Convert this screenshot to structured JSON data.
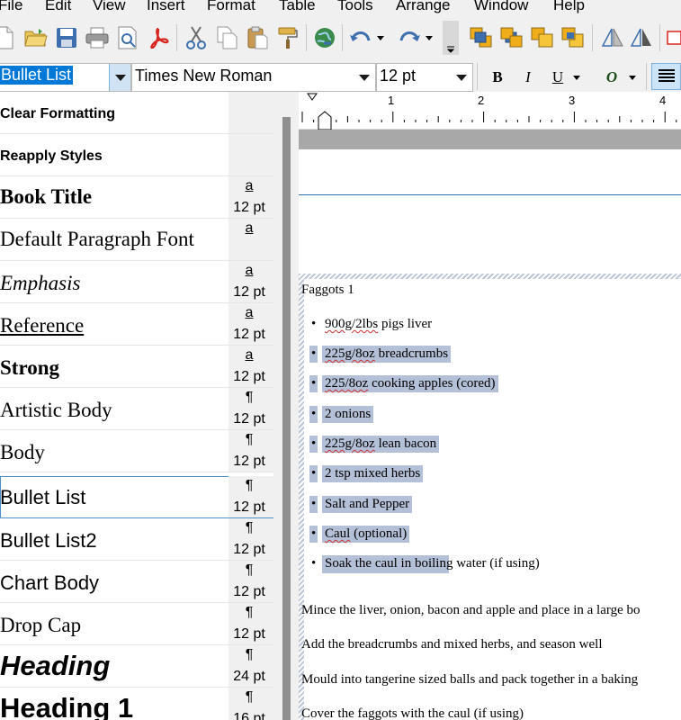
{
  "menu": [
    "File",
    "Edit",
    "View",
    "Insert",
    "Format",
    "Table",
    "Tools",
    "Arrange",
    "Window",
    "Help"
  ],
  "toolbar": {
    "icons": [
      "new-document-icon",
      "open-folder-icon",
      "save-icon",
      "print-icon",
      "print-preview-icon",
      "pdf-export-icon",
      "cut-icon",
      "copy-icon",
      "paste-icon",
      "format-painter-icon",
      "insert-hyperlink-icon",
      "undo-icon",
      "redo-icon",
      "bring-to-front-icon",
      "send-to-back-icon",
      "bring-forward-icon",
      "send-backward-icon",
      "flip-horizontal-icon",
      "flip-vertical-icon"
    ]
  },
  "format": {
    "style": "Bullet List",
    "font": "Times New Roman",
    "size": "12 pt",
    "bold": "B",
    "italic": "I",
    "underline": "U",
    "outline": "O"
  },
  "styles": [
    {
      "name": "Clear Formatting",
      "glyph": "",
      "size": ""
    },
    {
      "name": "Reapply Styles",
      "glyph": "",
      "size": ""
    },
    {
      "name": "Book Title",
      "glyph": "a",
      "size": "12 pt"
    },
    {
      "name": "Default Paragraph Font",
      "glyph": "a",
      "size": ""
    },
    {
      "name": "Emphasis",
      "glyph": "a",
      "size": "12 pt"
    },
    {
      "name": "Reference",
      "glyph": "a",
      "size": "12 pt"
    },
    {
      "name": "Strong",
      "glyph": "a",
      "size": "12 pt"
    },
    {
      "name": "Artistic Body",
      "glyph": "¶",
      "size": "12 pt"
    },
    {
      "name": "Body",
      "glyph": "¶",
      "size": "12 pt"
    },
    {
      "name": "Bullet List",
      "glyph": "¶",
      "size": "12 pt"
    },
    {
      "name": "Bullet List2",
      "glyph": "¶",
      "size": "12 pt"
    },
    {
      "name": "Chart Body",
      "glyph": "¶",
      "size": "12 pt"
    },
    {
      "name": "Drop Cap",
      "glyph": "¶",
      "size": "12 pt"
    },
    {
      "name": "Heading",
      "glyph": "¶",
      "size": "24 pt"
    },
    {
      "name": "Heading 1",
      "glyph": "¶",
      "size": "16 pt"
    }
  ],
  "ruler": [
    "1",
    "2",
    "3",
    "4"
  ],
  "document": {
    "title": "Faggots 1",
    "ingredients": [
      {
        "pre": "900g/2lbs",
        "text": " pigs liver"
      },
      {
        "pre": "225g/8oz",
        "text": " breadcrumbs"
      },
      {
        "pre": "225/8oz",
        "text": " cooking apples (cored)"
      },
      {
        "pre": "",
        "text": "2 onions"
      },
      {
        "pre": "225g/8oz",
        "text": " lean bacon"
      },
      {
        "pre": "",
        "text": "2 tsp mixed herbs"
      },
      {
        "pre": "",
        "text": "Salt and Pepper"
      },
      {
        "pre": "Caul",
        "text": " (optional)"
      },
      {
        "pre": "",
        "text": "Soak the caul in boiling water (if using)"
      }
    ],
    "method": [
      "Mince the liver, onion, bacon and apple and place in a large bo",
      "Add the breadcrumbs and mixed herbs, and season well",
      "Mould into tangerine sized balls and pack together in a baking",
      "Cover the faggots with the caul (if using)"
    ]
  }
}
